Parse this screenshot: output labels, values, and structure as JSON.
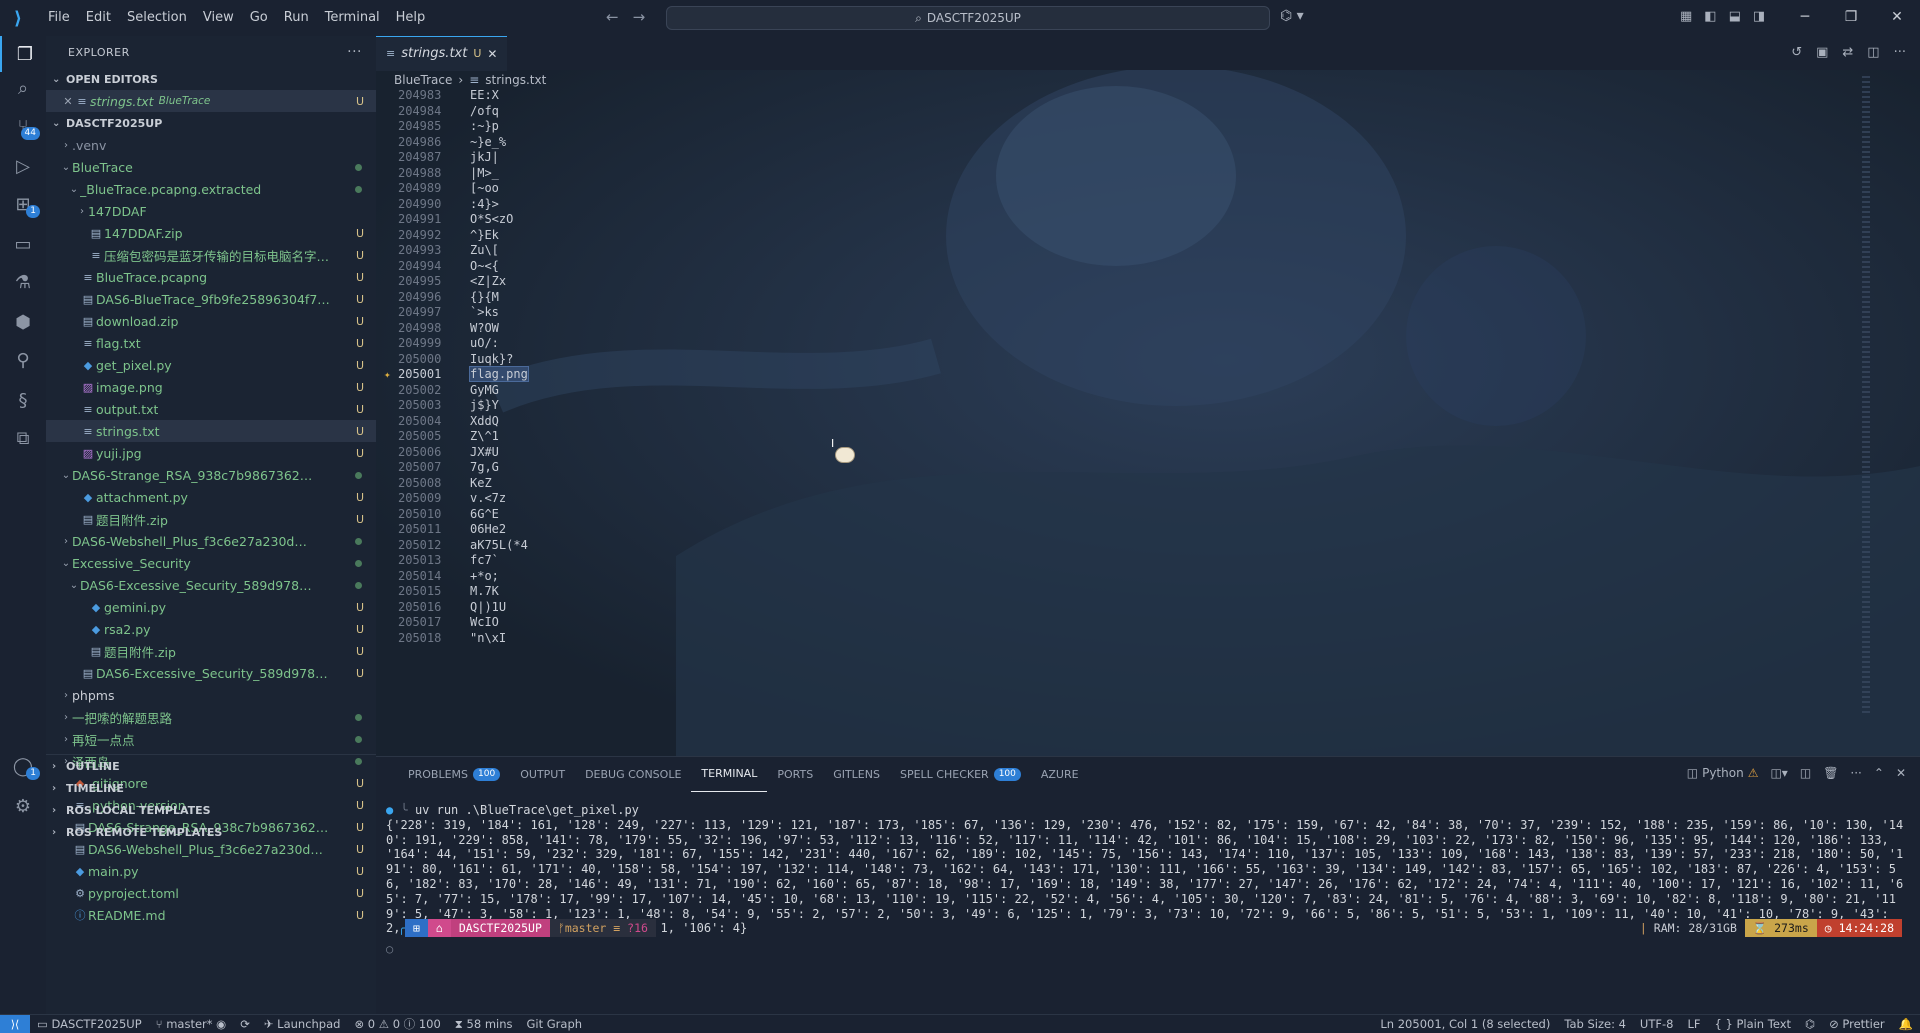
{
  "menu": [
    "File",
    "Edit",
    "Selection",
    "View",
    "Go",
    "Run",
    "Terminal",
    "Help"
  ],
  "command_center": "DASCTF2025UP",
  "sidebar": {
    "title": "EXPLORER",
    "open_editors_label": "OPEN EDITORS",
    "open_editor": {
      "name": "strings.txt",
      "folder": "BlueTrace",
      "status": "U"
    },
    "root_label": "DASCTF2025UP",
    "outline": "OUTLINE",
    "timeline": "TIMELINE",
    "ros_local": "ROS LOCAL TEMPLATES",
    "ros_remote": "ROS REMOTE TEMPLATES",
    "tree": [
      {
        "name": ".venv",
        "indent": 1,
        "twisty": ">",
        "icon": "",
        "status": "",
        "cls": "dim"
      },
      {
        "name": "BlueTrace",
        "indent": 1,
        "twisty": "v",
        "icon": "",
        "status": "dot",
        "cls": "g"
      },
      {
        "name": "_BlueTrace.pcapng.extracted",
        "indent": 2,
        "twisty": "v",
        "icon": "",
        "status": "dot",
        "cls": "g"
      },
      {
        "name": "147DDAF",
        "indent": 3,
        "twisty": ">",
        "icon": "",
        "status": "",
        "cls": "g"
      },
      {
        "name": "147DDAF.zip",
        "indent": 3,
        "twisty": "",
        "icon": "▤",
        "status": "U",
        "cls": "g"
      },
      {
        "name": "压缩包密码是蓝牙传输的目标电脑名字.txt",
        "indent": 3,
        "twisty": "",
        "icon": "≡",
        "status": "U",
        "cls": "g"
      },
      {
        "name": "BlueTrace.pcapng",
        "indent": 2,
        "twisty": "",
        "icon": "≡",
        "status": "U",
        "cls": "g"
      },
      {
        "name": "DAS6-BlueTrace_9fb9fe25896304f7ec2d3a3...",
        "indent": 2,
        "twisty": "",
        "icon": "▤",
        "status": "U",
        "cls": "g"
      },
      {
        "name": "download.zip",
        "indent": 2,
        "twisty": "",
        "icon": "▤",
        "status": "U",
        "cls": "g"
      },
      {
        "name": "flag.txt",
        "indent": 2,
        "twisty": "",
        "icon": "≡",
        "status": "U",
        "cls": "g"
      },
      {
        "name": "get_pixel.py",
        "indent": 2,
        "twisty": "",
        "icon": "py",
        "status": "U",
        "cls": "g"
      },
      {
        "name": "image.png",
        "indent": 2,
        "twisty": "",
        "icon": "img",
        "status": "U",
        "cls": "g"
      },
      {
        "name": "output.txt",
        "indent": 2,
        "twisty": "",
        "icon": "≡",
        "status": "U",
        "cls": "g"
      },
      {
        "name": "strings.txt",
        "indent": 2,
        "twisty": "",
        "icon": "≡",
        "status": "U",
        "cls": "g",
        "selected": true
      },
      {
        "name": "yuji.jpg",
        "indent": 2,
        "twisty": "",
        "icon": "img",
        "status": "U",
        "cls": "g"
      },
      {
        "name": "DAS6-Strange_RSA_938c7b986736231ce9fd...",
        "indent": 1,
        "twisty": "v",
        "icon": "",
        "status": "dot",
        "cls": "g"
      },
      {
        "name": "attachment.py",
        "indent": 2,
        "twisty": "",
        "icon": "py",
        "status": "U",
        "cls": "g"
      },
      {
        "name": "题目附件.zip",
        "indent": 2,
        "twisty": "",
        "icon": "▤",
        "status": "U",
        "cls": "g"
      },
      {
        "name": "DAS6-Webshell_Plus_f3c6e27a230d3788c73...",
        "indent": 1,
        "twisty": ">",
        "icon": "",
        "status": "dot",
        "cls": "g"
      },
      {
        "name": "Excessive_Security",
        "indent": 1,
        "twisty": "v",
        "icon": "",
        "status": "dot",
        "cls": "g"
      },
      {
        "name": "DAS6-Excessive_Security_589d9783b3a7ae...",
        "indent": 2,
        "twisty": "v",
        "icon": "",
        "status": "dot",
        "cls": "g"
      },
      {
        "name": "gemini.py",
        "indent": 3,
        "twisty": "",
        "icon": "py",
        "status": "U",
        "cls": "g"
      },
      {
        "name": "rsa2.py",
        "indent": 3,
        "twisty": "",
        "icon": "py",
        "status": "U",
        "cls": "g"
      },
      {
        "name": "题目附件.zip",
        "indent": 3,
        "twisty": "",
        "icon": "▤",
        "status": "U",
        "cls": "g"
      },
      {
        "name": "DAS6-Excessive_Security_589d9783b3a7ae...",
        "indent": 2,
        "twisty": "",
        "icon": "▤",
        "status": "U",
        "cls": "g"
      },
      {
        "name": "phpms",
        "indent": 1,
        "twisty": ">",
        "icon": "",
        "status": "",
        "cls": ""
      },
      {
        "name": "一把嗦的解题思路",
        "indent": 1,
        "twisty": ">",
        "icon": "",
        "status": "dot",
        "cls": "g"
      },
      {
        "name": "再短一点点",
        "indent": 1,
        "twisty": ">",
        "icon": "",
        "status": "dot",
        "cls": "g"
      },
      {
        "name": "泽西岛",
        "indent": 1,
        "twisty": ">",
        "icon": "",
        "status": "dot",
        "cls": "g"
      },
      {
        "name": ".gitignore",
        "indent": 1,
        "twisty": "",
        "icon": "◆",
        "status": "U",
        "cls": "g"
      },
      {
        "name": ".python-version",
        "indent": 1,
        "twisty": "",
        "icon": "≡",
        "status": "U",
        "cls": "g"
      },
      {
        "name": "DAS6-Strange_RSA_938c7b986736231ce9fd5...",
        "indent": 1,
        "twisty": "",
        "icon": "▤",
        "status": "U",
        "cls": "g"
      },
      {
        "name": "DAS6-Webshell_Plus_f3c6e27a230d3788c734...",
        "indent": 1,
        "twisty": "",
        "icon": "▤",
        "status": "U",
        "cls": "g"
      },
      {
        "name": "main.py",
        "indent": 1,
        "twisty": "",
        "icon": "py",
        "status": "U",
        "cls": "g"
      },
      {
        "name": "pyproject.toml",
        "indent": 1,
        "twisty": "",
        "icon": "⚙",
        "status": "U",
        "cls": "g"
      },
      {
        "name": "README.md",
        "indent": 1,
        "twisty": "",
        "icon": "info",
        "status": "U",
        "cls": "g"
      }
    ]
  },
  "editor": {
    "tab": {
      "name": "strings.txt",
      "status": "U"
    },
    "breadcrumb": [
      "BlueTrace",
      "strings.txt"
    ],
    "lines": [
      {
        "n": "204983",
        "t": "EE:X"
      },
      {
        "n": "204984",
        "t": "/ofq"
      },
      {
        "n": "204985",
        "t": ":~}p"
      },
      {
        "n": "204986",
        "t": "~}e_%"
      },
      {
        "n": "204987",
        "t": "jkJ|"
      },
      {
        "n": "204988",
        "t": "|M>_"
      },
      {
        "n": "204989",
        "t": "[~oo"
      },
      {
        "n": "204990",
        "t": ":4}>"
      },
      {
        "n": "204991",
        "t": "O*S<zO"
      },
      {
        "n": "204992",
        "t": "^}Ek"
      },
      {
        "n": "204993",
        "t": "Zu\\["
      },
      {
        "n": "204994",
        "t": "O~<{"
      },
      {
        "n": "204995",
        "t": "<Z|Zx"
      },
      {
        "n": "204996",
        "t": "{}{M"
      },
      {
        "n": "204997",
        "t": "`>ks"
      },
      {
        "n": "204998",
        "t": "W?OW"
      },
      {
        "n": "204999",
        "t": "uO/:"
      },
      {
        "n": "205000",
        "t": "Iuqk}?"
      },
      {
        "n": "205001",
        "t": "flag.png",
        "current": true
      },
      {
        "n": "205002",
        "t": "GyMG"
      },
      {
        "n": "205003",
        "t": "j$}Y"
      },
      {
        "n": "205004",
        "t": "XddQ"
      },
      {
        "n": "205005",
        "t": "Z\\^1"
      },
      {
        "n": "205006",
        "t": "JX#U"
      },
      {
        "n": "205007",
        "t": "7g,G"
      },
      {
        "n": "205008",
        "t": "KeZ"
      },
      {
        "n": "205009",
        "t": "v.<7z"
      },
      {
        "n": "205010",
        "t": "6G^E"
      },
      {
        "n": "205011",
        "t": "06He2"
      },
      {
        "n": "205012",
        "t": "aK75L(*4"
      },
      {
        "n": "205013",
        "t": "fc7`"
      },
      {
        "n": "205014",
        "t": "+*o;"
      },
      {
        "n": "205015",
        "t": "M.7K"
      },
      {
        "n": "205016",
        "t": "Q|)1U"
      },
      {
        "n": "205017",
        "t": "WcIO"
      },
      {
        "n": "205018",
        "t": "\"n\\xI"
      }
    ]
  },
  "panel": {
    "tabs": [
      {
        "label": "PROBLEMS",
        "count": "100"
      },
      {
        "label": "OUTPUT",
        "count": ""
      },
      {
        "label": "DEBUG CONSOLE",
        "count": ""
      },
      {
        "label": "TERMINAL",
        "count": "",
        "active": true
      },
      {
        "label": "PORTS",
        "count": ""
      },
      {
        "label": "GITLENS",
        "count": ""
      },
      {
        "label": "SPELL CHECKER",
        "count": "100"
      },
      {
        "label": "AZURE",
        "count": ""
      }
    ],
    "terminal_profile": "Python",
    "command": "uv run .\\BlueTrace\\get_pixel.py",
    "output": "{'228': 319, '184': 161, '128': 249, '227': 113, '129': 121, '187': 173, '185': 67, '136': 129, '230': 476, '152': 82, '175': 159, '67': 42, '84': 38, '70': 37, '239': 152, '188': 235, '159': 86, '10': 130, '140': 191, '229': 858, '141': 78, '179': 55, '32': 196, '97': 53, '112': 13, '116': 52, '117': 11, '114': 42, '101': 86, '104': 15, '108': 29, '103': 22, '173': 82, '150': 96, '135': 95, '144': 120, '186': 133, '164': 44, '151': 59, '232': 329, '181': 67, '155': 142, '231': 440, '167': 62, '189': 102, '145': 75, '156': 143, '174': 110, '137': 105, '133': 109, '168': 143, '138': 83, '139': 57, '233': 218, '180': 50, '191': 80, '161': 61, '171': 40, '158': 58, '154': 197, '132': 114, '148': 73, '162': 64, '143': 171, '130': 111, '166': 55, '163': 39, '134': 149, '142': 83, '157': 65, '165': 102, '183': 87, '226': 4, '153': 56, '182': 83, '170': 28, '146': 49, '131': 71, '190': 62, '160': 65, '87': 18, '98': 17, '169': 18, '149': 38, '177': 27, '147': 26, '176': 62, '172': 24, '74': 4, '111': 40, '100': 17, '121': 16, '102': 11, '65': 7, '77': 15, '178': 17, '99': 17, '107': 14, '45': 10, '68': 13, '110': 19, '115': 22, '52': 4, '56': 4, '105': 30, '120': 7, '83': 24, '81': 5, '76': 4, '88': 3, '69': 10, '82': 8, '118': 9, '80': 21, '119': 5, '47': 3, '58': 1, '123': 1, '48': 8, '54': 9, '55': 2, '57': 2, '50': 3, '49': 6, '125': 1, '79': 3, '73': 10, '72': 9, '66': 5, '86': 5, '51': 5, '53': 1, '109': 11, '40': 10, '41': 10, '78': 9, '43': 2, '71': 8, '124': 2, '122': 2, '85': 1, '106': 4}",
    "prompt_dir": "DASCTF2025UP",
    "prompt_branch": "master",
    "prompt_changes": "?16",
    "ram": "RAM: 28/31GB",
    "duration": "273ms",
    "time": "14:24:28"
  },
  "status": {
    "remote": "⟩⟨",
    "workspace": "DASCTF2025UP",
    "branch": "master*",
    "launchpad": "Launchpad",
    "errors": "0",
    "warnings": "0",
    "info": "100",
    "elapsed": "58 mins",
    "git_graph": "Git Graph",
    "position": "Ln 205001, Col 1 (8 selected)",
    "tab_size": "Tab Size: 4",
    "encoding": "UTF-8",
    "eol": "LF",
    "language": "Plain Text",
    "prettier": "Prettier"
  },
  "colors": {
    "accent": "#3aa6f0",
    "badge": "#2e7fd6",
    "git_untracked": "#d8c38a",
    "folder_green": "#7ec48c"
  }
}
